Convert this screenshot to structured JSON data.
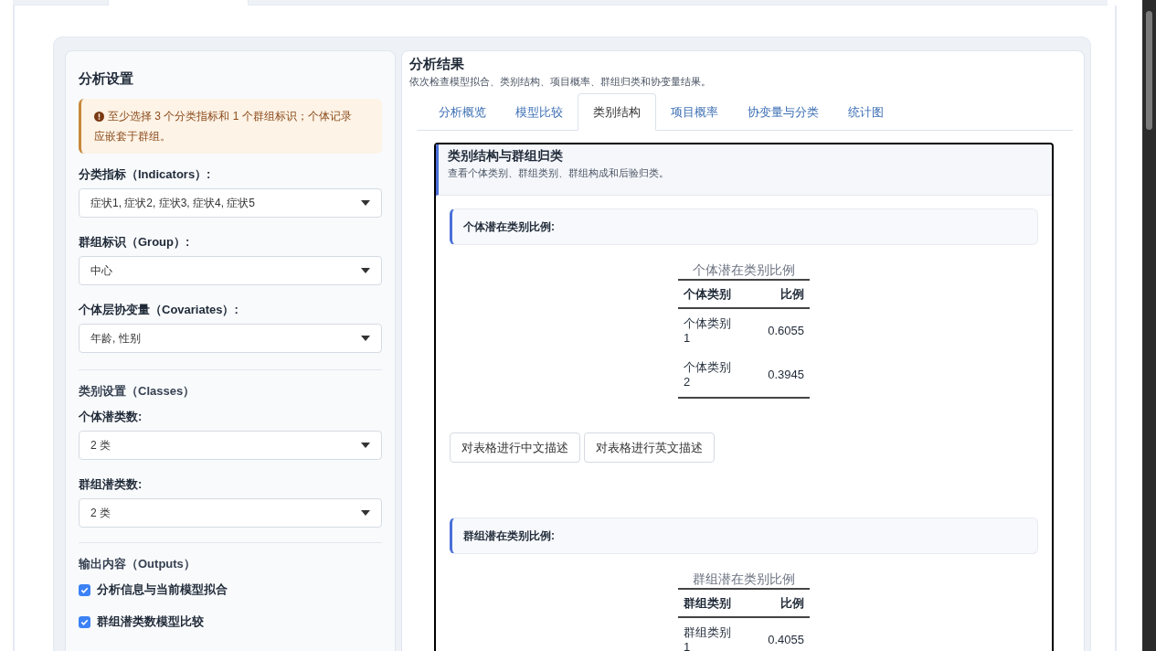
{
  "top_tabs": [
    {
      "selected": false
    },
    {
      "selected": true
    },
    {
      "selected": false
    }
  ],
  "settings": {
    "title": "分析设置",
    "alert": "至少选择 3 个分类指标和 1 个群组标识；个体记录应嵌套于群组。",
    "fields": [
      {
        "label": "分类指标（Indicators）:",
        "value": "症状1, 症状2, 症状3, 症状4, 症状5"
      },
      {
        "label": "群组标识（Group）:",
        "value": "中心"
      },
      {
        "label": "个体层协变量（Covariates）:",
        "value": "年龄, 性别"
      }
    ],
    "classes": {
      "heading": "类别设置（Classes）",
      "fields": [
        {
          "label": "个体潜类数:",
          "value": "2 类"
        },
        {
          "label": "群组潜类数:",
          "value": "2 类"
        }
      ]
    },
    "outputs": {
      "heading": "输出内容（Outputs）",
      "options": [
        {
          "label": "分析信息与当前模型拟合",
          "checked": true
        },
        {
          "label": "群组潜类数模型比较",
          "checked": true
        }
      ]
    }
  },
  "results": {
    "title": "分析结果",
    "subtitle": "依次检查模型拟合、类别结构、项目概率、群组归类和协变量结果。",
    "tabs": [
      {
        "label": "分析概览",
        "selected": false
      },
      {
        "label": "模型比较",
        "selected": false
      },
      {
        "label": "类别结构",
        "selected": true
      },
      {
        "label": "项目概率",
        "selected": false
      },
      {
        "label": "协变量与分类",
        "selected": false
      },
      {
        "label": "统计图",
        "selected": false
      }
    ],
    "card": {
      "title": "类别结构与群组归类",
      "subtitle": "查看个体类别、群组类别、群组构成和后验归类。",
      "sections": [
        {
          "heading": "个体潜在类别比例:",
          "table": {
            "caption": "个体潜在类别比例",
            "columns": [
              "个体类别",
              "比例"
            ],
            "rows": [
              [
                "个体类别 1",
                "0.6055"
              ],
              [
                "个体类别 2",
                "0.3945"
              ]
            ]
          },
          "buttons": [
            "对表格进行中文描述",
            "对表格进行英文描述"
          ]
        },
        {
          "heading": "群组潜在类别比例:",
          "table": {
            "caption": "群组潜在类别比例",
            "columns": [
              "群组类别",
              "比例"
            ],
            "rows": [
              [
                "群组类别 1",
                "0.4055"
              ]
            ]
          }
        }
      ]
    }
  }
}
